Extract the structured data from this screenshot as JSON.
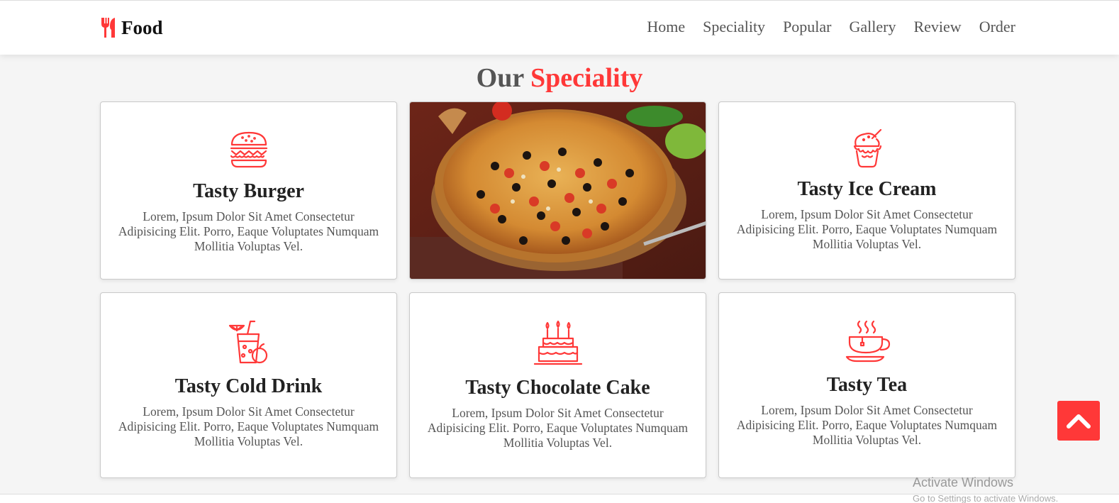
{
  "brand": {
    "name": "Food",
    "icon": "utensils-icon"
  },
  "nav": [
    "Home",
    "Speciality",
    "Popular",
    "Gallery",
    "Review",
    "Order"
  ],
  "heading": {
    "main": "Our",
    "accent": "Speciality"
  },
  "cards": [
    {
      "title": "Tasty Burger",
      "text": "Lorem, Ipsum Dolor Sit Amet Consectetur Adipisicing Elit. Porro, Eaque Voluptates Numquam Mollitia Voluptas Vel.",
      "icon": "burger-icon"
    },
    {
      "title": "",
      "text": "",
      "icon": "pizza-image"
    },
    {
      "title": "Tasty Ice Cream",
      "text": "Lorem, Ipsum Dolor Sit Amet Consectetur Adipisicing Elit. Porro, Eaque Voluptates Numquam Mollitia Voluptas Vel.",
      "icon": "ice-cream-icon"
    },
    {
      "title": "Tasty Cold Drink",
      "text": "Lorem, Ipsum Dolor Sit Amet Consectetur Adipisicing Elit. Porro, Eaque Voluptates Numquam Mollitia Voluptas Vel.",
      "icon": "cold-drink-icon"
    },
    {
      "title": "Tasty Chocolate Cake",
      "text": "Lorem, Ipsum Dolor Sit Amet Consectetur Adipisicing Elit. Porro, Eaque Voluptates Numquam Mollitia Voluptas Vel.",
      "icon": "cake-icon"
    },
    {
      "title": "Tasty Tea",
      "text": "Lorem, Ipsum Dolor Sit Amet Consectetur Adipisicing Elit. Porro, Eaque Voluptates Numquam Mollitia Voluptas Vel.",
      "icon": "tea-cup-icon"
    }
  ],
  "scroll_top": {
    "icon": "chevron-up-icon"
  },
  "watermark": {
    "title": "Activate Windows",
    "subtitle": "Go to Settings to activate Windows."
  },
  "colors": {
    "accent": "#ff3838",
    "background": "#f5f5f5",
    "heading": "#555555"
  }
}
